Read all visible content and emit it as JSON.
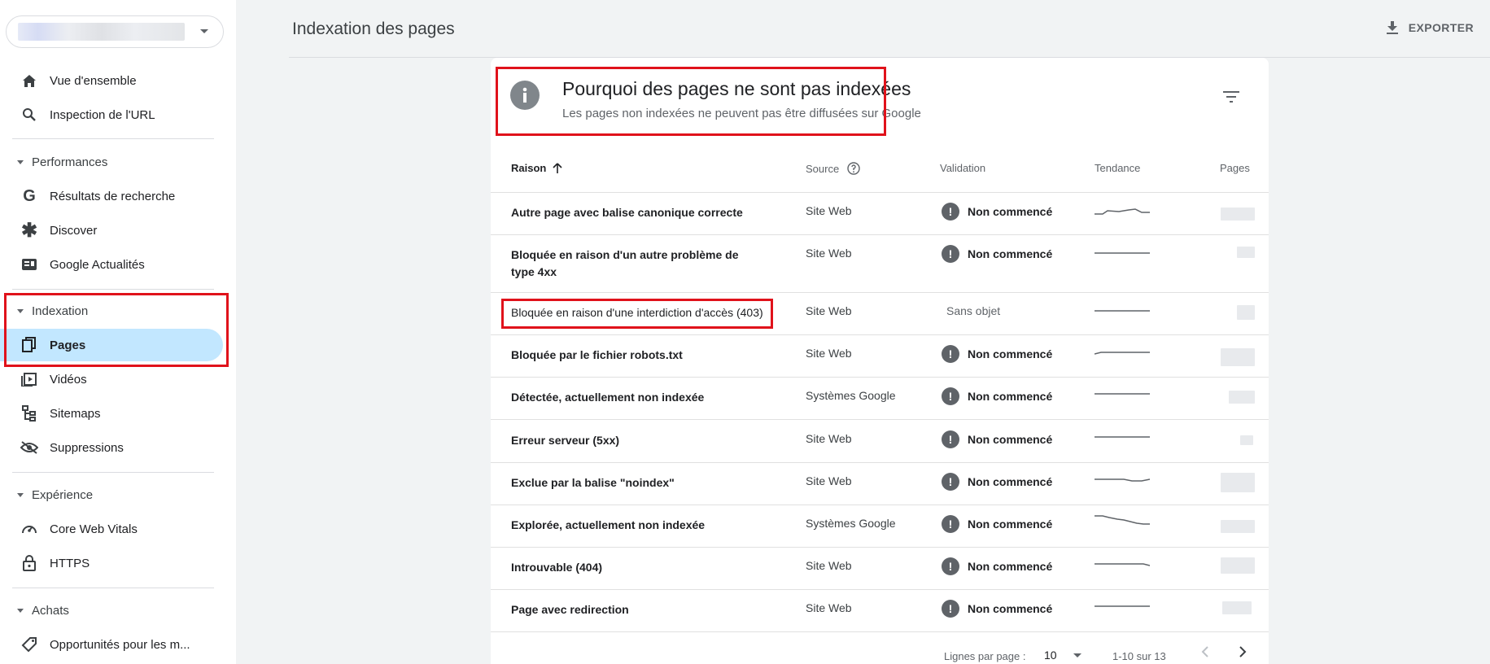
{
  "sidebar": {
    "overview": "Vue d'ensemble",
    "url_inspection": "Inspection de l'URL",
    "sections": {
      "performance": "Performances",
      "indexing": "Indexation",
      "experience": "Expérience",
      "shopping": "Achats"
    },
    "items": {
      "search_results": "Résultats de recherche",
      "discover": "Discover",
      "google_news": "Google Actualités",
      "pages": "Pages",
      "videos": "Vidéos",
      "sitemaps": "Sitemaps",
      "removals": "Suppressions",
      "core_web_vitals": "Core Web Vitals",
      "https": "HTTPS",
      "opportunities": "Opportunités pour les m..."
    }
  },
  "header": {
    "title": "Indexation des pages",
    "export_label": "EXPORTER"
  },
  "card": {
    "title": "Pourquoi des pages ne sont pas indexées",
    "subtitle": "Les pages non indexées ne peuvent pas être diffusées sur Google"
  },
  "table": {
    "columns": {
      "reason": "Raison",
      "source": "Source",
      "validation": "Validation",
      "trend": "Tendance",
      "pages": "Pages"
    },
    "rows": [
      {
        "reason": "Autre page avec balise canonique correcte",
        "source": "Site Web",
        "validation": "Non commencé"
      },
      {
        "reason": "Bloquée en raison d'un autre problème de type 4xx",
        "source": "Site Web",
        "validation": "Non commencé"
      },
      {
        "reason": "Bloquée en raison d'une interdiction d'accès (403)",
        "source": "Site Web",
        "validation": "Sans objet"
      },
      {
        "reason": "Bloquée par le fichier robots.txt",
        "source": "Site Web",
        "validation": "Non commencé"
      },
      {
        "reason": "Détectée, actuellement non indexée",
        "source": "Systèmes Google",
        "validation": "Non commencé"
      },
      {
        "reason": "Erreur serveur (5xx)",
        "source": "Site Web",
        "validation": "Non commencé"
      },
      {
        "reason": "Exclue par la balise \"noindex\"",
        "source": "Site Web",
        "validation": "Non commencé"
      },
      {
        "reason": "Explorée, actuellement non indexée",
        "source": "Systèmes Google",
        "validation": "Non commencé"
      },
      {
        "reason": "Introuvable (404)",
        "source": "Site Web",
        "validation": "Non commencé"
      },
      {
        "reason": "Page avec redirection",
        "source": "Site Web",
        "validation": "Non commencé"
      }
    ]
  },
  "pagination": {
    "rows_per_page_label": "Lignes par page :",
    "rows_per_page_value": "10",
    "range": "1-10 sur 13"
  },
  "colors": {
    "highlight": "#e0121b",
    "active_nav": "#c2e7ff"
  }
}
